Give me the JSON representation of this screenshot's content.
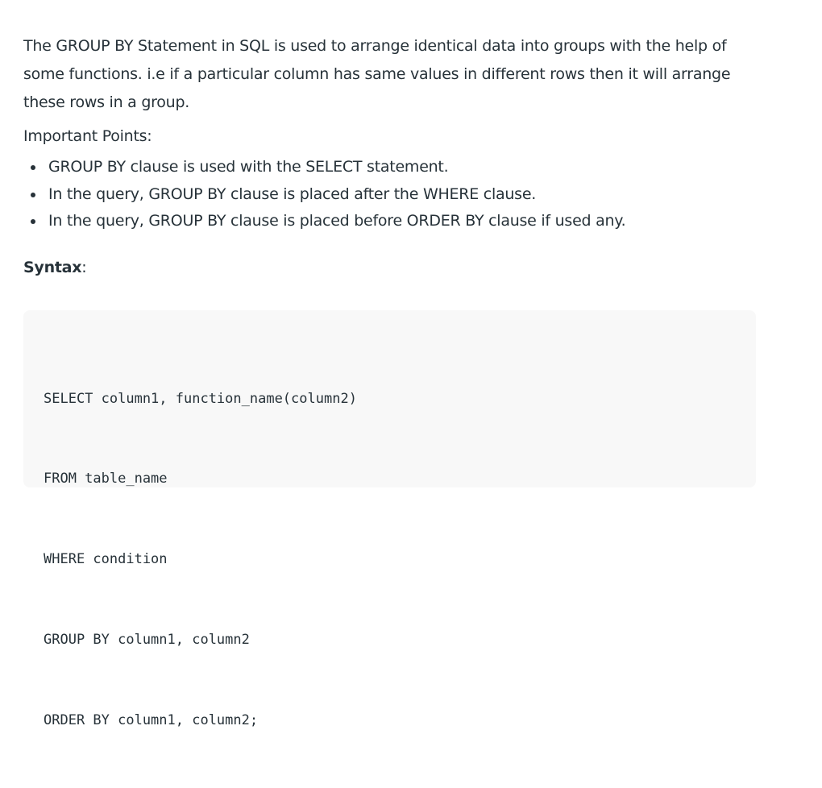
{
  "intro": "The GROUP BY Statement in SQL is used to arrange identical data into groups with the help of some functions. i.e if a particular column has same values in different rows then it will arrange these rows in a group.",
  "points_heading": "Important Points:",
  "points": [
    "GROUP BY clause is used with the SELECT statement.",
    "In the query, GROUP BY clause is placed after the WHERE clause.",
    "In the query, GROUP BY clause is placed before ORDER BY clause if used any."
  ],
  "syntax": {
    "label": "Syntax",
    "suffix": ":"
  },
  "code": {
    "lines": [
      "SELECT column1, function_name(column2)",
      "FROM table_name",
      "WHERE condition",
      "GROUP BY column1, column2",
      "ORDER BY column1, column2;"
    ]
  }
}
